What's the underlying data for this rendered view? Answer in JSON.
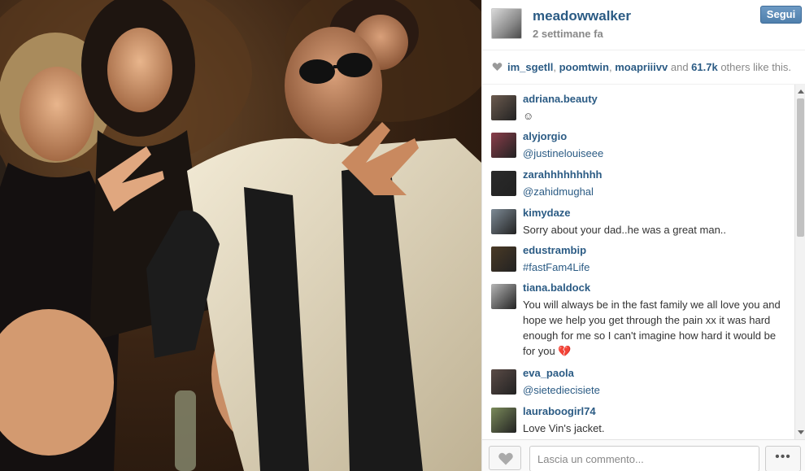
{
  "post": {
    "username": "meadowwalker",
    "timestamp": "2 settimane fa",
    "follow_label": "Segui"
  },
  "likes": {
    "users": [
      "im_sgetll",
      "poomtwin",
      "moapriiivv"
    ],
    "sep1": ", ",
    "sep2": ", ",
    "and_text": " and ",
    "count": "61.7k",
    "suffix": " others like this."
  },
  "comments": [
    {
      "user": "adriana.beauty",
      "text": "☺",
      "mention": false,
      "avatar_color": "#6b5a4e"
    },
    {
      "user": "alyjorgio",
      "text": "@justinelouiseee",
      "mention": true,
      "avatar_color": "#8a3d4a"
    },
    {
      "user": "zarahhhhhhhhh",
      "text": "@zahidmughal",
      "mention": true,
      "avatar_color": "#2a2a2a"
    },
    {
      "user": "kimydaze",
      "text": "Sorry about your dad..he was a great man..",
      "mention": false,
      "avatar_color": "#7d8a95"
    },
    {
      "user": "edustrambip",
      "text": "#fastFam4Life",
      "mention": true,
      "avatar_color": "#4a3a26"
    },
    {
      "user": "tiana.baldock",
      "text": "You will always be in the fast family we all love you and hope we help you get through the pain xx it was hard enough for me so I can't imagine how hard it would be for you 💔",
      "mention": false,
      "avatar_color": "#b5b5b5"
    },
    {
      "user": "eva_paola",
      "text": "@siete­diecisiete",
      "mention": true,
      "avatar_color": "#5a4b46"
    },
    {
      "user": "lauraboogirl74",
      "text": "Love Vin's jacket.",
      "mention": false,
      "avatar_color": "#7a8a5a"
    }
  ],
  "composer": {
    "placeholder": "Lascia un commento...",
    "more_label": "•••"
  },
  "icons": {
    "heart": "heart-icon",
    "more": "more-options-icon"
  }
}
